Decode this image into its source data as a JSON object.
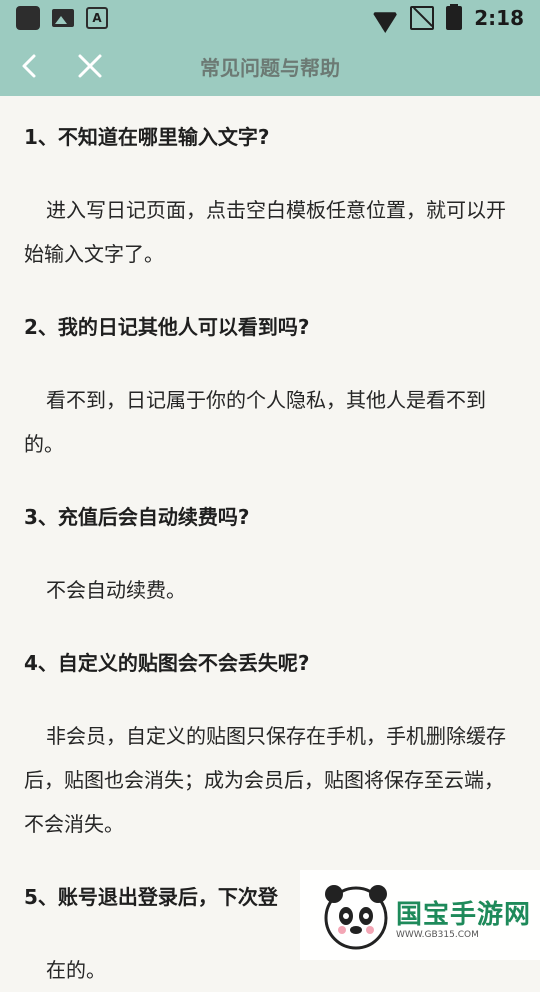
{
  "status": {
    "time": "2:18",
    "left_icons": [
      "app-icon",
      "image-icon",
      "a-icon"
    ],
    "right_icons": [
      "wifi-icon",
      "no-sim-icon",
      "battery-charging-icon"
    ]
  },
  "nav": {
    "title": "常见问题与帮助",
    "back_icon": "chevron-left-icon",
    "close_icon": "close-icon"
  },
  "faq": [
    {
      "q": "1、不知道在哪里输入文字?",
      "a": "进入写日记页面，点击空白模板任意位置，就可以开始输入文字了。"
    },
    {
      "q": "2、我的日记其他人可以看到吗?",
      "a": "看不到，日记属于你的个人隐私，其他人是看不到的。"
    },
    {
      "q": "3、充值后会自动续费吗?",
      "a": "不会自动续费。"
    },
    {
      "q": "4、自定义的贴图会不会丢失呢?",
      "a": "非会员，自定义的贴图只保存在手机，手机删除缓存后，贴图也会消失；成为会员后，贴图将保存至云端，不会消失。"
    },
    {
      "q": "5、账号退出登录后，下次登",
      "a": "在的。"
    }
  ],
  "watermark": {
    "brand": "国宝手游网",
    "url": "WWW.GB315.COM"
  }
}
